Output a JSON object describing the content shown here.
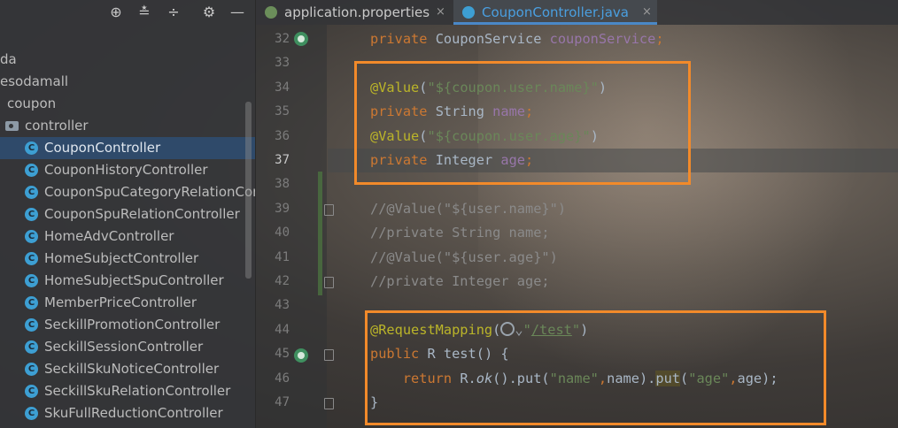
{
  "project_tree": {
    "toolbar_icons": [
      "locate-icon",
      "expand-all-icon",
      "collapse-all-icon",
      "settings-icon",
      "minimize-icon"
    ],
    "rows": [
      {
        "label": "da",
        "kind": "text"
      },
      {
        "label": "esodamall",
        "kind": "text"
      },
      {
        "label": "coupon",
        "kind": "text"
      },
      {
        "label": "controller",
        "kind": "folder"
      },
      {
        "label": "CouponController",
        "kind": "class",
        "selected": true
      },
      {
        "label": "CouponHistoryController",
        "kind": "class"
      },
      {
        "label": "CouponSpuCategoryRelationCon",
        "kind": "class"
      },
      {
        "label": "CouponSpuRelationController",
        "kind": "class"
      },
      {
        "label": "HomeAdvController",
        "kind": "class"
      },
      {
        "label": "HomeSubjectController",
        "kind": "class"
      },
      {
        "label": "HomeSubjectSpuController",
        "kind": "class"
      },
      {
        "label": "MemberPriceController",
        "kind": "class"
      },
      {
        "label": "SeckillPromotionController",
        "kind": "class"
      },
      {
        "label": "SeckillSessionController",
        "kind": "class"
      },
      {
        "label": "SeckillSkuNoticeController",
        "kind": "class"
      },
      {
        "label": "SeckillSkuRelationController",
        "kind": "class"
      },
      {
        "label": "SkuFullReductionController",
        "kind": "class"
      }
    ]
  },
  "tabs": [
    {
      "label": "application.properties",
      "icon": "properties-icon",
      "close": "×"
    },
    {
      "label": "CouponController.java",
      "icon": "class-icon",
      "close": "×",
      "active": true
    }
  ],
  "editor": {
    "line_numbers": [
      "32",
      "33",
      "34",
      "35",
      "36",
      "37",
      "38",
      "39",
      "40",
      "41",
      "42",
      "43",
      "44",
      "45",
      "46",
      "47"
    ],
    "current_line": "37",
    "lines": [
      [
        {
          "t": "private ",
          "c": "kw"
        },
        {
          "t": "CouponService ",
          "c": ""
        },
        {
          "t": "couponService",
          "c": "fld"
        },
        {
          "t": ";",
          "c": "kw"
        }
      ],
      [],
      [
        {
          "t": "@Value",
          "c": "ann"
        },
        {
          "t": "(",
          "c": ""
        },
        {
          "t": "\"${coupon.user.name}\"",
          "c": "str"
        },
        {
          "t": ")",
          "c": ""
        }
      ],
      [
        {
          "t": "private ",
          "c": "kw"
        },
        {
          "t": "String ",
          "c": ""
        },
        {
          "t": "name",
          "c": "fld"
        },
        {
          "t": ";",
          "c": "kw"
        }
      ],
      [
        {
          "t": "@Value",
          "c": "ann"
        },
        {
          "t": "(",
          "c": ""
        },
        {
          "t": "\"${coupon.user.age}\"",
          "c": "str"
        },
        {
          "t": ")",
          "c": ""
        }
      ],
      [
        {
          "t": "private ",
          "c": "kw"
        },
        {
          "t": "Integer ",
          "c": ""
        },
        {
          "t": "age",
          "c": "fld"
        },
        {
          "t": ";",
          "c": "kw"
        }
      ],
      [],
      [
        {
          "t": "//@Value(\"${user.name}\")",
          "c": "cmt"
        }
      ],
      [
        {
          "t": "//private String name;",
          "c": "cmt"
        }
      ],
      [
        {
          "t": "//@Value(\"${user.age}\")",
          "c": "cmt"
        }
      ],
      [
        {
          "t": "//private Integer age;",
          "c": "cmt"
        }
      ],
      [],
      [
        {
          "t": "@RequestMapping",
          "c": "ann"
        },
        {
          "t": "(",
          "c": ""
        },
        {
          "t": "PILL",
          "c": "pill"
        },
        {
          "t": "\"",
          "c": "str"
        },
        {
          "t": "/test",
          "c": "str ul"
        },
        {
          "t": "\"",
          "c": "str"
        },
        {
          "t": ")",
          "c": ""
        }
      ],
      [
        {
          "t": "public ",
          "c": "kw"
        },
        {
          "t": "R ",
          "c": ""
        },
        {
          "t": "test",
          "c": ""
        },
        {
          "t": "() {",
          "c": ""
        }
      ],
      [
        {
          "t": "    return ",
          "c": "kw"
        },
        {
          "t": "R.",
          "c": ""
        },
        {
          "t": "ok",
          "c": "it"
        },
        {
          "t": "().put(",
          "c": ""
        },
        {
          "t": "\"name\"",
          "c": "str"
        },
        {
          "t": ",",
          "c": "kw"
        },
        {
          "t": "name).",
          "c": ""
        },
        {
          "t": "put",
          "c": "hl"
        },
        {
          "t": "(",
          "c": ""
        },
        {
          "t": "\"age\"",
          "c": "str"
        },
        {
          "t": ",",
          "c": "kw"
        },
        {
          "t": "age);",
          "c": ""
        }
      ],
      [
        {
          "t": "}",
          "c": ""
        }
      ]
    ],
    "highlight_color": "#f28a2a"
  }
}
